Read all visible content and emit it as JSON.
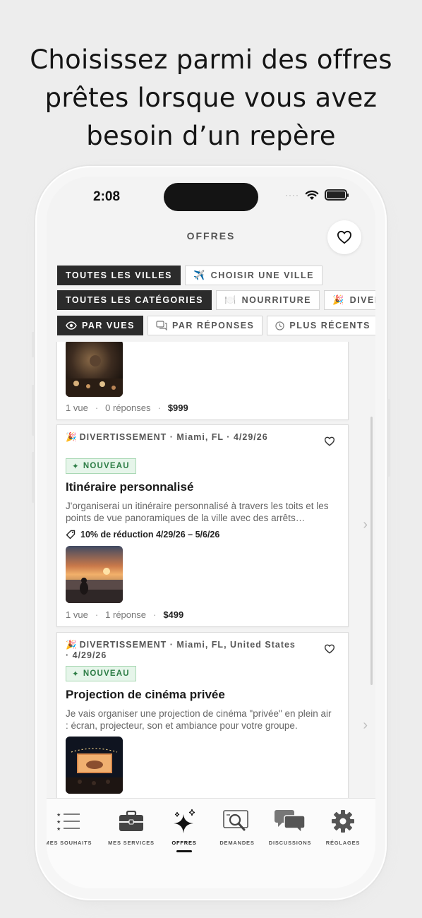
{
  "headline": [
    "Choisissez parmi des offres",
    "prêtes lorsque vous avez",
    "besoin d’un repère"
  ],
  "status": {
    "time": "2:08",
    "dots": "····"
  },
  "nav": {
    "title": "OFFRES"
  },
  "filters": {
    "cities": [
      {
        "label": "TOUTES LES VILLES",
        "active": true
      },
      {
        "label": "CHOISIR UNE VILLE",
        "icon": "✈️",
        "active": false
      }
    ],
    "categories": [
      {
        "label": "TOUTES LES CATÉGORIES",
        "active": true
      },
      {
        "label": "NOURRITURE",
        "icon": "🍽️",
        "active": false
      },
      {
        "label": "DIVERTISS",
        "icon": "🎉",
        "active": false
      }
    ],
    "sort": [
      {
        "label": "PAR VUES",
        "active": true
      },
      {
        "label": "PAR RÉPONSES",
        "active": false
      },
      {
        "label": "PLUS RÉCENTS",
        "active": false
      }
    ]
  },
  "offers": [
    {
      "stats": {
        "views": "1 vue",
        "replies": "0 réponses",
        "price": "$999"
      }
    },
    {
      "category_icon": "🎉",
      "meta": "DIVERTISSEMENT · Miami, FL · 4/29/26",
      "badge": "NOUVEAU",
      "title": "Itinéraire personnalisé",
      "description": "J'organiserai un itinéraire personnalisé à travers les toits et les points de vue panoramiques de la ville avec des arrêts…",
      "discount": "10% de réduction 4/29/26 – 5/6/26",
      "stats": {
        "views": "1 vue",
        "replies": "1 réponse",
        "price": "$499"
      }
    },
    {
      "category_icon": "🎉",
      "meta": "DIVERTISSEMENT · Miami, FL, United States · 4/29/26",
      "badge": "NOUVEAU",
      "title": "Projection de cinéma privée",
      "description": "Je vais organiser une projection de cinéma \"privée\" en plein air : écran, projecteur, son et ambiance pour votre groupe."
    }
  ],
  "tabs": [
    {
      "label": "MES SOUHAITS",
      "icon": "list-stars-icon"
    },
    {
      "label": "MES SERVICES",
      "icon": "briefcase-icon"
    },
    {
      "label": "OFFRES",
      "icon": "sparkles-icon",
      "active": true
    },
    {
      "label": "DEMANDES",
      "icon": "search-card-icon"
    },
    {
      "label": "DISCUSSIONS",
      "icon": "chat-bubbles-icon"
    },
    {
      "label": "RÉGLAGES",
      "icon": "gear-icon"
    }
  ],
  "colors": {
    "dark": "#2b2b2b",
    "badge_green": "#2e7d46",
    "badge_bg": "#e6f5ea"
  }
}
